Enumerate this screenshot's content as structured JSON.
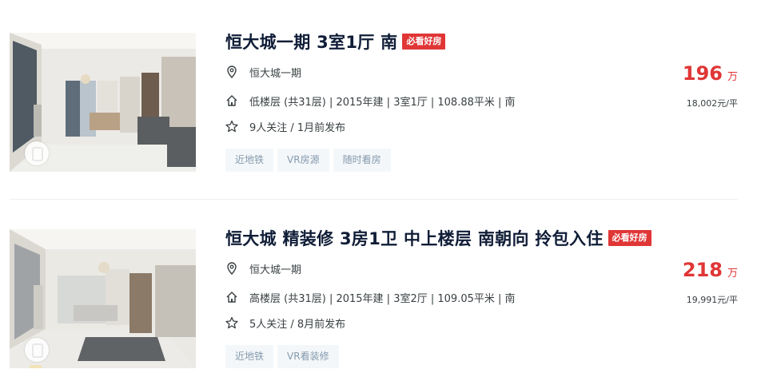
{
  "listings": [
    {
      "title": "恒大城一期 3室1厅 南",
      "badge": "必看好房",
      "community": "恒大城一期",
      "house_info": "低楼层 (共31层) | 2015年建 | 3室1厅 | 108.88平米 | 南",
      "follow_info": "9人关注 / 1月前发布",
      "tags": [
        "近地铁",
        "VR房源",
        "随时看房"
      ],
      "total_price": "196",
      "total_price_unit": "万",
      "unit_price": "18,002元/平"
    },
    {
      "title": "恒大城 精装修 3房1卫 中上楼层 南朝向 拎包入住",
      "badge": "必看好房",
      "community": "恒大城一期",
      "house_info": "高楼层 (共31层) | 2015年建 | 3室2厅 | 109.05平米 | 南",
      "follow_info": "5人关注 / 8月前发布",
      "tags": [
        "近地铁",
        "VR看装修"
      ],
      "total_price": "218",
      "total_price_unit": "万",
      "unit_price": "19,991元/平"
    }
  ],
  "colors": {
    "accent_red": "#e03636",
    "title": "#101d37",
    "tag_bg": "#f4f7f9",
    "tag_text": "#849aae"
  },
  "icons": [
    "location-pin-icon",
    "house-icon",
    "star-icon",
    "vr-icon"
  ]
}
